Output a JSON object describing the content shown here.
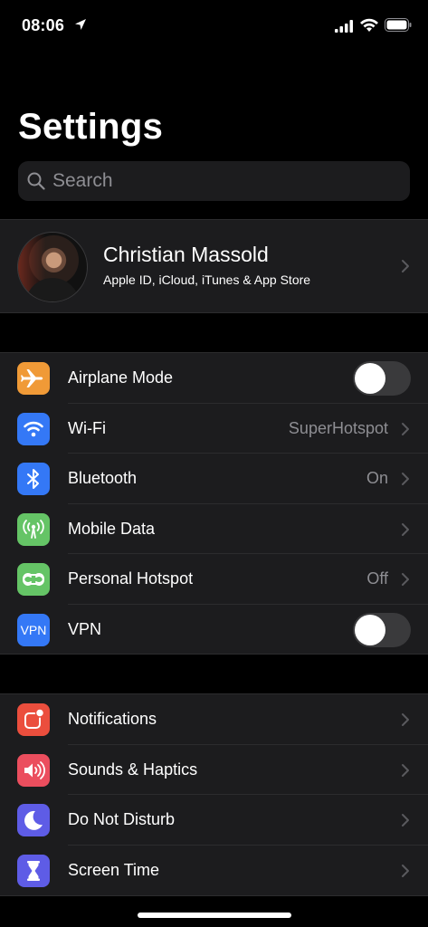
{
  "status_bar": {
    "time": "08:06"
  },
  "title": "Settings",
  "search": {
    "placeholder": "Search"
  },
  "profile": {
    "name": "Christian Massold",
    "subtitle": "Apple ID, iCloud, iTunes & App Store"
  },
  "network": {
    "airplane": {
      "label": "Airplane Mode",
      "enabled": false,
      "icon": "airplane-icon",
      "color": "#f09a37"
    },
    "wifi": {
      "label": "Wi-Fi",
      "value": "SuperHotspot",
      "icon": "wifi-icon",
      "color": "#3478f6"
    },
    "bluetooth": {
      "label": "Bluetooth",
      "value": "On",
      "icon": "bluetooth-icon",
      "color": "#3478f6"
    },
    "mobile_data": {
      "label": "Mobile Data",
      "icon": "antenna-icon",
      "color": "#65c466"
    },
    "hotspot": {
      "label": "Personal Hotspot",
      "value": "Off",
      "icon": "hotspot-icon",
      "color": "#65c466"
    },
    "vpn": {
      "label": "VPN",
      "icon_text": "VPN",
      "enabled": false,
      "color": "#3478f6"
    }
  },
  "general": {
    "notifications": {
      "label": "Notifications",
      "icon": "notifications-icon",
      "color": "#eb4e3d"
    },
    "sounds": {
      "label": "Sounds & Haptics",
      "icon": "speaker-icon",
      "color": "#eb4e5e"
    },
    "dnd": {
      "label": "Do Not Disturb",
      "icon": "moon-icon",
      "color": "#5e5ce6"
    },
    "screen_time": {
      "label": "Screen Time",
      "icon": "hourglass-icon",
      "color": "#5e5ce6"
    }
  }
}
